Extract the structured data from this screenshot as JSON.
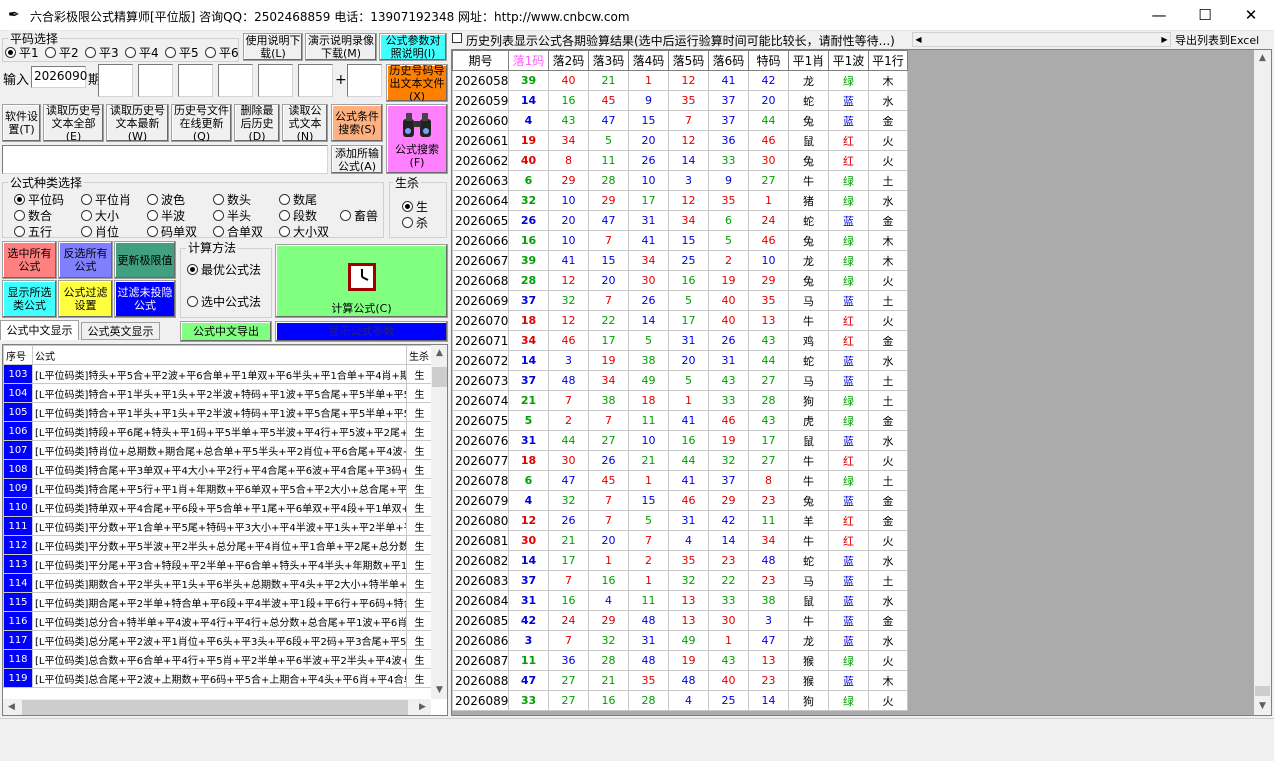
{
  "window": {
    "title": "六合彩极限公式精算师[平位版]  咨询QQ：2502468859 电话：13907192348 网址：http://www.cnbcw.com",
    "minimize": "—",
    "maximize": "☐",
    "close": "✕"
  },
  "left": {
    "pingma_group": "平码选择",
    "pingma_options": [
      "平1",
      "平2",
      "平3",
      "平4",
      "平5",
      "平6"
    ],
    "pingma_selected": 0,
    "btn_usage": "使用说明下载(L)",
    "btn_demo": "演示说明录像下载(M)",
    "btn_params": "公式参数对照说明(I)",
    "input_label": "输入",
    "input_value": "2026090",
    "period_label": "期",
    "plus": "+",
    "btn_history_file": "历史号码导出文本文件(X)",
    "toolbar": [
      "软件设置(T)",
      "读取历史号文本全部(E)",
      "读取历史号文本最新(W)",
      "历史号文件在线更新(Q)",
      "删除最后历史(D)",
      "读取公式文本(N)"
    ],
    "btn_condition_search": "公式条件搜索(S)",
    "btn_add_formula": "添加所输公式(A)",
    "btn_formula_search": "公式搜索(F)",
    "type_group": "公式种类选择",
    "type_options": [
      [
        "平位码",
        "平位肖",
        "波色",
        "数头",
        "数尾"
      ],
      [
        "数合",
        "大小",
        "半波",
        "半头",
        "段数",
        "畜兽"
      ],
      [
        "五行",
        "肖位",
        "码单双",
        "合单双",
        "大小双"
      ]
    ],
    "shengsha_group": "生杀",
    "shengsha_options": [
      "生",
      "杀"
    ],
    "btn_select_all": "选中所有公式",
    "btn_invert": "反选所有公式",
    "btn_update_limit": "更新极限值",
    "btn_show_type": "显示所选类公式",
    "btn_filter": "公式过滤设置",
    "btn_filter_formula": "过滤未投隐公式",
    "calc_group": "计算方法",
    "calc_options": [
      "最优公式法",
      "选中公式法"
    ],
    "btn_calc": "计算公式(C)",
    "tab_cn": "公式中文显示",
    "tab_en": "公式英文显示",
    "btn_export_cn": "公式中文导出",
    "btn_show_params": "显示公式参数",
    "formula_headers": [
      "序号",
      "公式",
      "生杀"
    ],
    "formula_rows": [
      [
        "103",
        "[L平位码类]特头+平5合+平2波+平6合单+平1单双+平6半头+平1合单+平4肖+期合",
        "生"
      ],
      [
        "104",
        "[L平位码类]特合+平1半头+平1头+平2半波+特码+平1波+平5合尾+平5半单+平5头",
        "生"
      ],
      [
        "105",
        "[L平位码类]特合+平1半头+平1头+平2半波+特码+平1波+平5合尾+平5半单+平5头",
        "生"
      ],
      [
        "106",
        "[L平位码类]特段+平6尾+特头+平1码+平5半单+平5半波+平4行+平5波+平2尾+平",
        "生"
      ],
      [
        "107",
        "[L平位码类]特肖位+总期数+期合尾+总合单+平5半头+平2肖位+平6合尾+平4波+",
        "生"
      ],
      [
        "108",
        "[L平位码类]特合尾+平3单双+平4大小+平2行+平4合尾+平6波+平4合尾+平3码+平",
        "生"
      ],
      [
        "109",
        "[L平位码类]特合尾+平5行+平1肖+年期数+平6单双+平5合+平2大小+总合尾+平分",
        "生"
      ],
      [
        "110",
        "[L平位码类]特单双+平4合尾+平6段+平5合单+平1尾+平6单双+平4段+平1单双+平",
        "生"
      ],
      [
        "111",
        "[L平位码类]平分数+平1合单+平5尾+特码+平3大小+平4半波+平1头+平2半单+平2",
        "生"
      ],
      [
        "112",
        "[L平位码类]平分数+平5半波+平2半头+总分尾+平4肖位+平1合单+平2尾+总分数+",
        "生"
      ],
      [
        "113",
        "[L平位码类]平分尾+平3合+特段+平2半单+平6合单+特头+平4半头+年期数+平1肖",
        "生"
      ],
      [
        "114",
        "[L平位码类]期数合+平2半头+平1头+平6半头+总期数+平4头+平2大小+特半单+平",
        "生"
      ],
      [
        "115",
        "[L平位码类]期合尾+平2半单+特合单+平6段+平4半波+平1段+平6行+平6码+特合",
        "生"
      ],
      [
        "116",
        "[L平位码类]总分合+特半单+平4波+平4行+平4行+总分数+总合尾+平1波+平6肖位",
        "生"
      ],
      [
        "117",
        "[L平位码类]总分尾+平2波+平1肖位+平6头+平3头+平6段+平2码+平3合尾+平5半",
        "生"
      ],
      [
        "118",
        "[L平位码类]总合数+平6合单+平4行+平5肖+平2半单+平6半波+平2半头+平4波+总",
        "生"
      ],
      [
        "119",
        "[L平位码类]总合尾+平2波+上期数+平6码+平5合+上期合+平4头+平6肖+平4合单+",
        "生"
      ]
    ]
  },
  "right": {
    "checkbox_label": "历史列表显示公式各期验算结果(选中后运行验算时间可能比较长，请耐性等待...)",
    "export_excel": "导出列表到Excel",
    "headers": [
      "期号",
      "落1码",
      "落2码",
      "落3码",
      "落4码",
      "落5码",
      "落6码",
      "特码",
      "平1肖",
      "平1波",
      "平1行"
    ],
    "rows": [
      [
        "2026058",
        "39",
        "40",
        "21",
        "1",
        "12",
        "41",
        "42",
        "龙",
        "绿",
        "木"
      ],
      [
        "2026059",
        "14",
        "16",
        "45",
        "9",
        "35",
        "37",
        "20",
        "蛇",
        "蓝",
        "水"
      ],
      [
        "2026060",
        "4",
        "43",
        "47",
        "15",
        "7",
        "37",
        "44",
        "兔",
        "蓝",
        "金"
      ],
      [
        "2026061",
        "19",
        "34",
        "5",
        "20",
        "12",
        "36",
        "46",
        "鼠",
        "红",
        "火"
      ],
      [
        "2026062",
        "40",
        "8",
        "11",
        "26",
        "14",
        "33",
        "30",
        "兔",
        "红",
        "火"
      ],
      [
        "2026063",
        "6",
        "29",
        "28",
        "10",
        "3",
        "9",
        "27",
        "牛",
        "绿",
        "土"
      ],
      [
        "2026064",
        "32",
        "10",
        "29",
        "17",
        "12",
        "35",
        "1",
        "猪",
        "绿",
        "水"
      ],
      [
        "2026065",
        "26",
        "20",
        "47",
        "31",
        "34",
        "6",
        "24",
        "蛇",
        "蓝",
        "金"
      ],
      [
        "2026066",
        "16",
        "10",
        "7",
        "41",
        "15",
        "5",
        "46",
        "兔",
        "绿",
        "木"
      ],
      [
        "2026067",
        "39",
        "41",
        "15",
        "34",
        "25",
        "2",
        "10",
        "龙",
        "绿",
        "木"
      ],
      [
        "2026068",
        "28",
        "12",
        "20",
        "30",
        "16",
        "19",
        "29",
        "兔",
        "绿",
        "火"
      ],
      [
        "2026069",
        "37",
        "32",
        "7",
        "26",
        "5",
        "40",
        "35",
        "马",
        "蓝",
        "土"
      ],
      [
        "2026070",
        "18",
        "12",
        "22",
        "14",
        "17",
        "40",
        "13",
        "牛",
        "红",
        "火"
      ],
      [
        "2026071",
        "34",
        "46",
        "17",
        "5",
        "31",
        "26",
        "43",
        "鸡",
        "红",
        "金"
      ],
      [
        "2026072",
        "14",
        "3",
        "19",
        "38",
        "20",
        "31",
        "44",
        "蛇",
        "蓝",
        "水"
      ],
      [
        "2026073",
        "37",
        "48",
        "34",
        "49",
        "5",
        "43",
        "27",
        "马",
        "蓝",
        "土"
      ],
      [
        "2026074",
        "21",
        "7",
        "38",
        "18",
        "1",
        "33",
        "28",
        "狗",
        "绿",
        "土"
      ],
      [
        "2026075",
        "5",
        "2",
        "7",
        "11",
        "41",
        "46",
        "43",
        "虎",
        "绿",
        "金"
      ],
      [
        "2026076",
        "31",
        "44",
        "27",
        "10",
        "16",
        "19",
        "17",
        "鼠",
        "蓝",
        "水"
      ],
      [
        "2026077",
        "18",
        "30",
        "26",
        "21",
        "44",
        "32",
        "27",
        "牛",
        "红",
        "火"
      ],
      [
        "2026078",
        "6",
        "47",
        "45",
        "1",
        "41",
        "37",
        "8",
        "牛",
        "绿",
        "土"
      ],
      [
        "2026079",
        "4",
        "32",
        "7",
        "15",
        "46",
        "29",
        "23",
        "兔",
        "蓝",
        "金"
      ],
      [
        "2026080",
        "12",
        "26",
        "7",
        "5",
        "31",
        "42",
        "11",
        "羊",
        "红",
        "金"
      ],
      [
        "2026081",
        "30",
        "21",
        "20",
        "7",
        "4",
        "14",
        "34",
        "牛",
        "红",
        "火"
      ],
      [
        "2026082",
        "14",
        "17",
        "1",
        "2",
        "35",
        "23",
        "48",
        "蛇",
        "蓝",
        "水"
      ],
      [
        "2026083",
        "37",
        "7",
        "16",
        "1",
        "32",
        "22",
        "23",
        "马",
        "蓝",
        "土"
      ],
      [
        "2026084",
        "31",
        "16",
        "4",
        "11",
        "13",
        "33",
        "38",
        "鼠",
        "蓝",
        "水"
      ],
      [
        "2026085",
        "42",
        "24",
        "29",
        "48",
        "13",
        "30",
        "3",
        "牛",
        "蓝",
        "金"
      ],
      [
        "2026086",
        "3",
        "7",
        "32",
        "31",
        "49",
        "1",
        "47",
        "龙",
        "蓝",
        "水"
      ],
      [
        "2026087",
        "11",
        "36",
        "28",
        "48",
        "19",
        "43",
        "13",
        "猴",
        "绿",
        "火"
      ],
      [
        "2026088",
        "47",
        "27",
        "21",
        "35",
        "48",
        "40",
        "23",
        "猴",
        "蓝",
        "木"
      ],
      [
        "2026089",
        "33",
        "27",
        "16",
        "28",
        "4",
        "25",
        "14",
        "狗",
        "绿",
        "火"
      ]
    ]
  },
  "colors": {
    "red": "#e00000",
    "blue": "#0000e0",
    "green": "#00a000",
    "pink": "#ff60ff",
    "orange": "#ff8000",
    "cyan": "#40ffff",
    "lightgreen": "#80ff80",
    "yellow": "#ffff40",
    "blue_btn": "#0000ff",
    "salmon": "#ff8080",
    "peach": "#ffb080",
    "purple": "#8080ff",
    "teal": "#40a080"
  }
}
